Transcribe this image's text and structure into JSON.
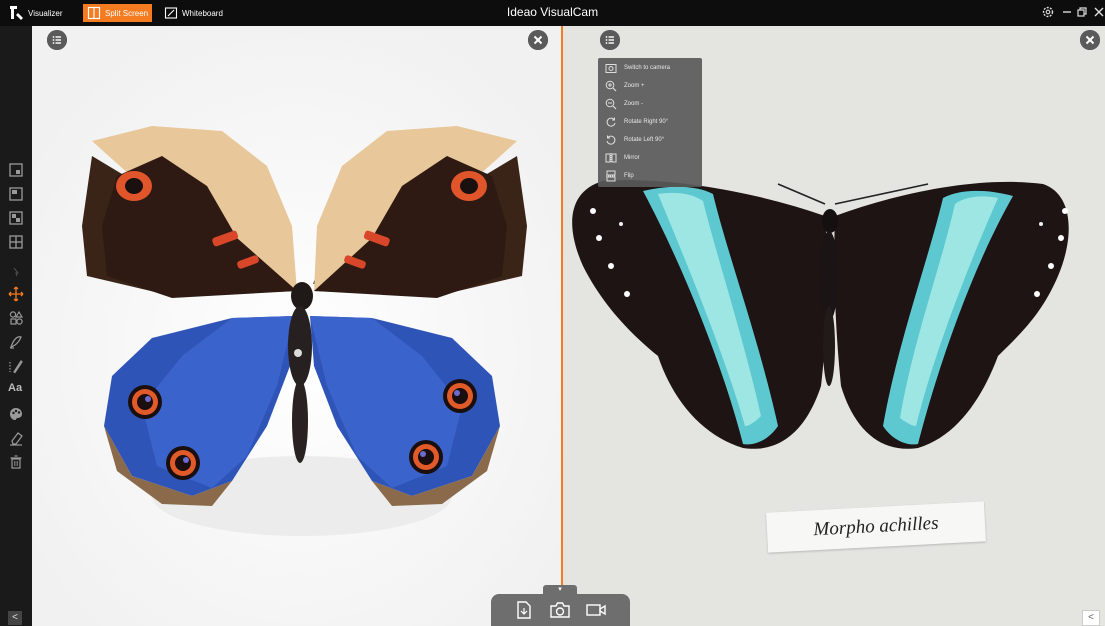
{
  "titlebar": {
    "app_title": "Ideao VisualCam",
    "modes": [
      {
        "label": "Visualizer",
        "icon": "visualizer-icon",
        "active": false
      },
      {
        "label": "Split Screen",
        "icon": "split-screen-icon",
        "active": true
      },
      {
        "label": "Whiteboard",
        "icon": "whiteboard-icon",
        "active": false
      }
    ],
    "window_buttons": [
      "settings-icon",
      "minimize-icon",
      "restore-icon",
      "close-icon"
    ]
  },
  "toolbar": {
    "tools": [
      "single-view-icon",
      "dual-view-icon",
      "quad-view-icon",
      "grid-view-icon",
      "cursor-icon",
      "move-icon",
      "shapes-icon",
      "highlighter-icon",
      "pen-icon",
      "text-icon",
      "color-palette-icon",
      "eraser-icon",
      "trash-icon"
    ],
    "text_tool_label": "Aa",
    "collapse_label": "<"
  },
  "menu": {
    "items": [
      {
        "label": "Switch to camera",
        "icon": "camera-switch-icon"
      },
      {
        "label": "Zoom +",
        "icon": "zoom-in-icon"
      },
      {
        "label": "Zoom -",
        "icon": "zoom-out-icon"
      },
      {
        "label": "Rotate Right 90°",
        "icon": "rotate-right-icon"
      },
      {
        "label": "Rotate Left 90°",
        "icon": "rotate-left-icon"
      },
      {
        "label": "Mirror",
        "icon": "mirror-icon"
      },
      {
        "label": "Flip",
        "icon": "flip-icon"
      }
    ]
  },
  "right_panel": {
    "specimen_label": "Morpho achilles",
    "collapse_label": "<"
  },
  "bottombar": {
    "tab_glyph": "▾",
    "buttons": [
      "import-document-icon",
      "capture-photo-icon",
      "record-video-icon"
    ]
  },
  "colors": {
    "accent": "#f47b20",
    "titlebar": "#0d0d0d",
    "toolbar": "#1a1a1a",
    "menu": "#5a5a5a"
  }
}
